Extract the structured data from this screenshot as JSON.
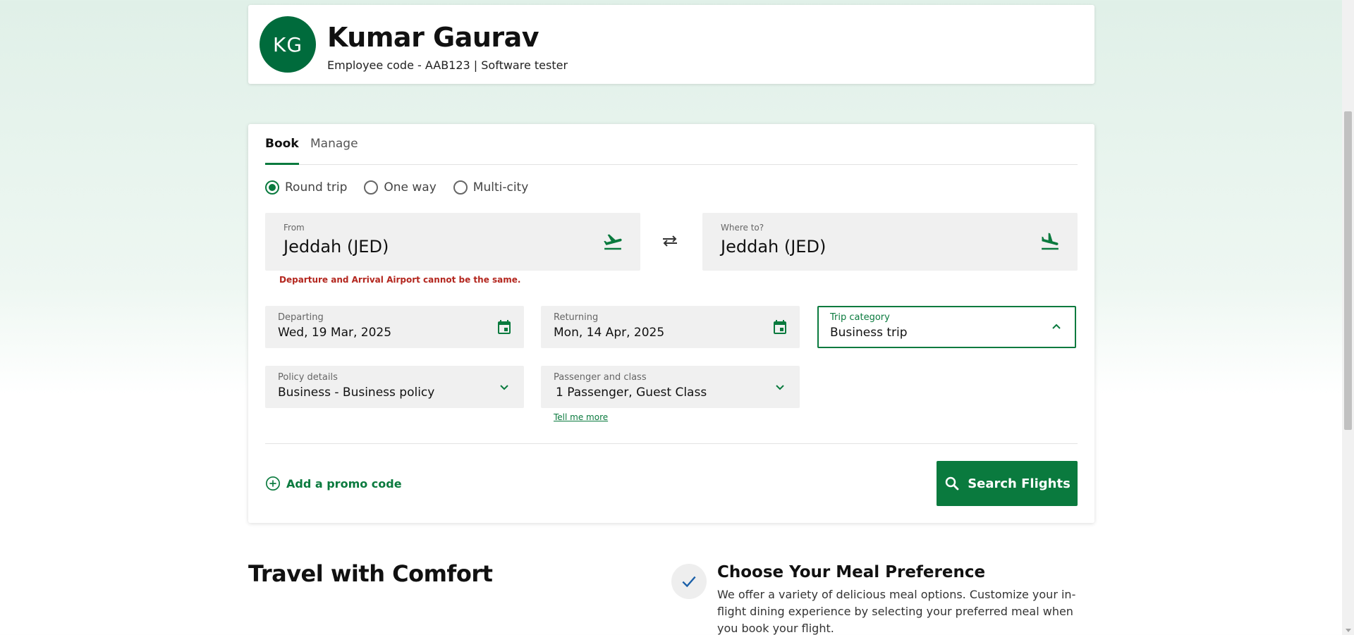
{
  "profile": {
    "initials": "KG",
    "name": "Kumar Gaurav",
    "subtitle": "Employee code - AAB123 | Software tester"
  },
  "tabs": [
    {
      "label": "Book",
      "active": true
    },
    {
      "label": "Manage",
      "active": false
    }
  ],
  "trip_types": [
    {
      "label": "Round trip",
      "selected": true
    },
    {
      "label": "One way",
      "selected": false
    },
    {
      "label": "Multi-city",
      "selected": false
    }
  ],
  "from": {
    "label": "From",
    "value": "Jeddah (JED)",
    "icon": "plane-takeoff-icon"
  },
  "to": {
    "label": "Where to?",
    "value": "Jeddah (JED)",
    "icon": "plane-landing-icon"
  },
  "swap_icon": "swap-arrows-icon",
  "error": "Departure and Arrival Airport cannot be the same.",
  "departing": {
    "label": "Departing",
    "value": "Wed, 19 Mar, 2025",
    "icon": "calendar-icon"
  },
  "returning": {
    "label": "Returning",
    "value": "Mon, 14 Apr, 2025",
    "icon": "calendar-icon"
  },
  "trip_category": {
    "label": "Trip category",
    "value": "Business trip",
    "icon": "chevron-up-icon"
  },
  "policy": {
    "label": "Policy details",
    "value": "Business - Business policy",
    "icon": "chevron-down-icon"
  },
  "passenger": {
    "label": "Passenger and class",
    "value": "1 Passenger, Guest Class",
    "icon": "chevron-down-icon",
    "help_link": "Tell me more"
  },
  "promo_label": "Add a promo code",
  "search_label": "Search Flights",
  "bottom": {
    "travel_title": "Travel with Comfort",
    "meal_title": "Choose Your Meal Preference",
    "meal_desc": "We offer a variety of delicious meal options. Customize your in-flight dining experience by selecting your preferred meal when you book your flight."
  },
  "colors": {
    "brand_green": "#0a7a3e",
    "avatar_green": "#006b3c",
    "error_red": "#b3261e"
  }
}
